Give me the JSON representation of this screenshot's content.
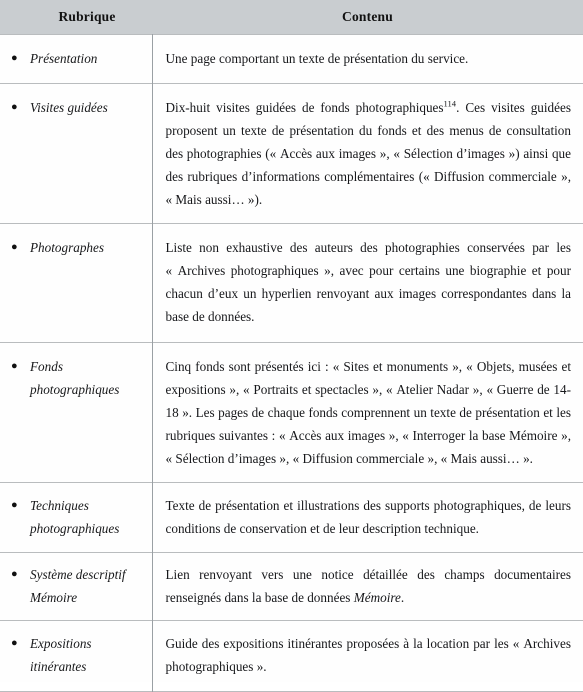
{
  "table": {
    "headers": {
      "rubrique": "Rubrique",
      "contenu": "Contenu"
    },
    "bullet_glyph": "●",
    "header_background": "#c9cdd0",
    "rows": [
      {
        "id": "presentation",
        "label_line1": "Présentation",
        "label_line2": "",
        "content": "Une page comportant un texte de présentation du service."
      },
      {
        "id": "visites",
        "label_line1": "Visites guidées",
        "label_line2": "",
        "content_part1": "Dix-huit visites guidées de fonds photographiques",
        "footnote": "114",
        "content_part2": ". Ces visites guidées proposent un texte de présentation du fonds et des menus de consultation des photographies (« Accès aux images », « Sélection d’images ») ainsi que des rubriques d’informations complémentaires (« Diffusion commerciale », « Mais aussi… »)."
      },
      {
        "id": "photographes",
        "label_line1": "Photographes",
        "label_line2": "",
        "content": "Liste non exhaustive des auteurs des photographies conservées par les « Archives photographiques », avec pour certains une biographie et pour chacun d’eux un hyperlien renvoyant aux images correspondantes dans la base de données."
      },
      {
        "id": "fonds",
        "label_line1": "Fonds",
        "label_line2": "photographiques",
        "content": "Cinq fonds sont présentés ici : « Sites et monuments », « Objets, musées et expositions », « Portraits et spectacles », « Atelier Nadar », « Guerre de 14-18 ». Les pages de chaque fonds comprennent un texte de présentation et les rubriques suivantes : « Accès aux images », « Interroger la base Mémoire », « Sélection d’images », « Diffusion commerciale », « Mais aussi… »."
      },
      {
        "id": "techniques",
        "label_line1": "Techniques",
        "label_line2": "photographiques",
        "content": "Texte de présentation et illustrations des supports photographiques, de leurs conditions de conservation et de leur description technique."
      },
      {
        "id": "systeme",
        "label_line1": "Système descriptif",
        "label_line2": "Mémoire",
        "content_part1": "Lien renvoyant vers une notice détaillée des champs documentaires renseignés dans la base de données ",
        "content_italic": "Mémoire",
        "content_part2": "."
      },
      {
        "id": "expositions",
        "label_line1": "Expositions",
        "label_line2": "itinérantes",
        "content": "Guide des expositions itinérantes proposées à la location par les « Archives photographiques »."
      }
    ]
  }
}
